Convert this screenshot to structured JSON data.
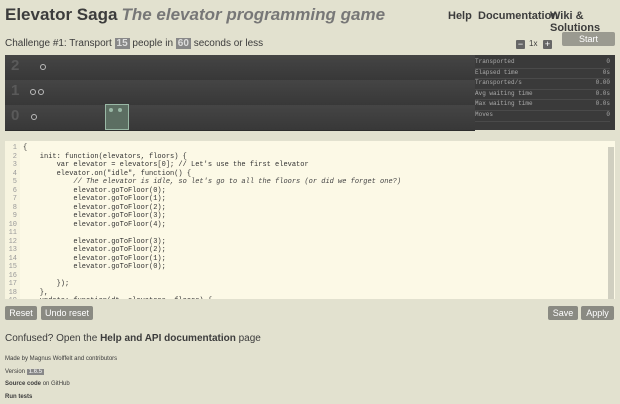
{
  "header": {
    "title": "Elevator Saga",
    "subtitle": "The elevator programming game",
    "nav": [
      "Help",
      "Documentation",
      "Wiki & Solutions"
    ]
  },
  "challenge": {
    "prefix": "Challenge #1: Transport",
    "people": "15",
    "middle": "people in",
    "seconds": "60",
    "suffix": "seconds or less"
  },
  "speed": {
    "minus": "−",
    "value": "1x",
    "plus": "+"
  },
  "start_label": "Start",
  "floors": [
    {
      "number": "2",
      "icon": "circle-icon"
    },
    {
      "number": "1",
      "icon": "circle-icon"
    },
    {
      "number": "0",
      "icon": "circle-icon"
    }
  ],
  "stats": [
    {
      "label": "Transported",
      "value": "0"
    },
    {
      "label": "Elapsed time",
      "value": "0s"
    },
    {
      "label": "Transported/s",
      "value": "0.00"
    },
    {
      "label": "Avg waiting time",
      "value": "0.0s"
    },
    {
      "label": "Max waiting time",
      "value": "0.0s"
    },
    {
      "label": "Moves",
      "value": "0"
    }
  ],
  "code_lines": [
    "{",
    "    init: function(elevators, floors) {",
    "        var elevator = elevators[0]; // Let's use the first elevator",
    "        elevator.on(\"idle\", function() {",
    "            // The elevator is idle, so let's go to all the floors (or did we forget one?)",
    "            elevator.goToFloor(0);",
    "            elevator.goToFloor(1);",
    "            elevator.goToFloor(2);",
    "            elevator.goToFloor(3);",
    "            elevator.goToFloor(4);",
    "",
    "            elevator.goToFloor(3);",
    "            elevator.goToFloor(2);",
    "            elevator.goToFloor(1);",
    "            elevator.goToFloor(0);",
    "",
    "        });",
    "    },",
    "    update: function(dt, elevators, floors) {"
  ],
  "buttons": {
    "reset": "Reset",
    "undo": "Undo reset",
    "save": "Save",
    "apply": "Apply"
  },
  "footer": {
    "confused_prefix": "Confused? Open the",
    "confused_link": "Help and API documentation",
    "confused_suffix": "page",
    "made_by": "Made by Magnus Wolffelt and contributors",
    "version_label": "Version",
    "version": "1.6.5",
    "source_link": "Source code",
    "source_suffix": "on GitHub",
    "run_tests": "Run tests"
  }
}
